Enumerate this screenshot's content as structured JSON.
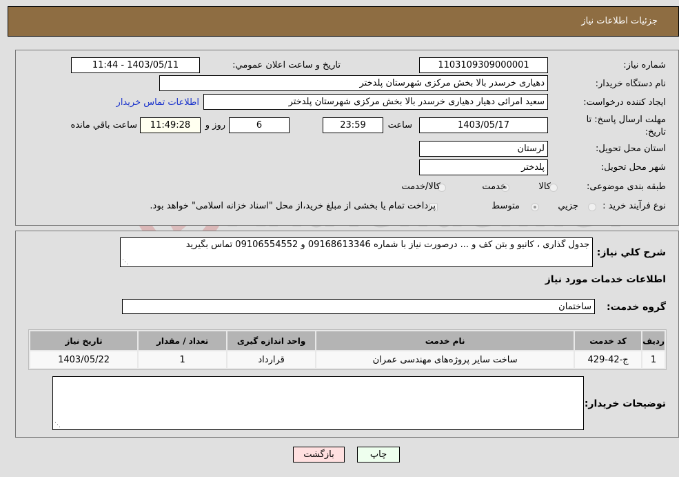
{
  "header": {
    "title": "جزئيات اطلاعات نياز"
  },
  "details": {
    "need_number_label": "شماره نیاز:",
    "need_number": "1103109309000001",
    "announce_label": "تاريخ و ساعت اعلان عمومي:",
    "announce_value": "1403/05/11 - 11:44",
    "buyer_org_label": "نام دستگاه خریدار:",
    "buyer_org": "دهیاری خرسدر بالا بخش مرکزی شهرستان پلدختر",
    "creator_label": "ایجاد کننده درخواست:",
    "creator": "سعید امرائی دهیار دهیاری خرسدر بالا بخش مرکزی شهرستان پلدختر",
    "contact_link": "اطلاعات تماس خریدار",
    "deadline_label": "مهلت ارسال پاسخ: تا تاریخ:",
    "deadline_date": "1403/05/17",
    "time_label": "ساعت",
    "deadline_time": "23:59",
    "days_value": "6",
    "days_label": "روز و",
    "remaining_time": "11:49:28",
    "remaining_label": "ساعت باقي مانده",
    "province_label": "استان محل تحویل:",
    "province": "لرستان",
    "city_label": "شهر محل تحویل:",
    "city": "پلدختر",
    "category_label": "طبقه بندی موضوعی:",
    "category_options": [
      {
        "label": "کالا",
        "selected": false
      },
      {
        "label": "خدمت",
        "selected": true
      },
      {
        "label": "کالا/خدمت",
        "selected": false
      }
    ],
    "process_label": "نوع فرآیند خرید :",
    "process_options": [
      {
        "label": "جزيي",
        "selected": false
      },
      {
        "label": "متوسط",
        "selected": true
      }
    ],
    "treasury_note": "پرداخت تمام یا بخشی از مبلغ خرید،از محل \"اسناد خزانه اسلامی\" خواهد بود."
  },
  "description": {
    "label": "شرح كلي نياز:",
    "text": "جدول گذاری ، کانیو و بتن کف و ... درصورت نیاز با شماره 09168613346 و 09106554552 تماس بگیرید"
  },
  "services": {
    "section_title": "اطلاعات خدمات مورد نياز",
    "group_label": "گروه خدمت:",
    "group_value": "ساختمان",
    "columns": [
      "رديف",
      "كد خدمت",
      "نام خدمت",
      "واحد اندازه گيری",
      "تعداد / مقدار",
      "تاريخ نياز"
    ],
    "rows": [
      [
        "1",
        "ج-42-429",
        "ساخت سایر پروژه‌های مهندسی عمران",
        "قرارداد",
        "1",
        "1403/05/22"
      ]
    ]
  },
  "buyer_notes": {
    "label": "توضيحات خريدار:",
    "text": ""
  },
  "buttons": {
    "print": "چاپ",
    "back": "بازگشت"
  },
  "watermark": {
    "text": "AriaTender.neT"
  }
}
